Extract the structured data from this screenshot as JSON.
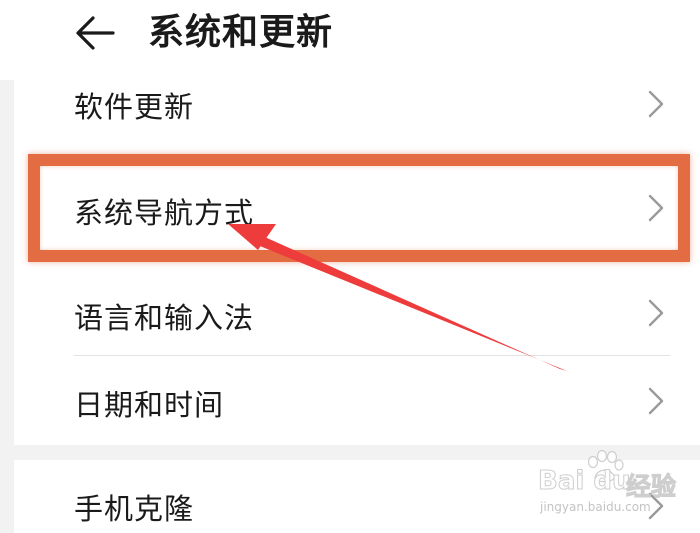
{
  "header": {
    "title": "系统和更新"
  },
  "menu": {
    "items": [
      {
        "label": "软件更新"
      },
      {
        "label": "系统导航方式"
      },
      {
        "label": "语言和输入法"
      },
      {
        "label": "日期和时间"
      },
      {
        "label": "手机克隆"
      }
    ]
  },
  "annotation": {
    "highlight_color": "#e46c43",
    "arrow_color": "#ee3b3b"
  },
  "watermark": {
    "brand": "Bai du",
    "sub": "经验",
    "url": "jingyan.baidu.com"
  },
  "icons": {
    "back": "arrow-left-icon",
    "chevron": "chevron-right-icon"
  }
}
